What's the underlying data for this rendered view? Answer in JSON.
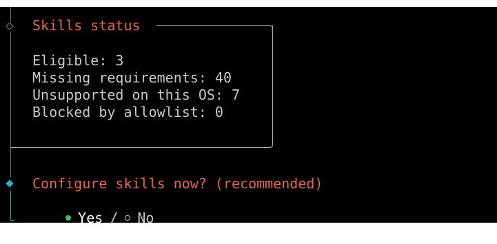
{
  "skills_status": {
    "title": "Skills status",
    "items": [
      {
        "label": "Eligible: 3"
      },
      {
        "label": "Missing requirements: 40"
      },
      {
        "label": "Unsupported on this OS: 7"
      },
      {
        "label": "Blocked by allowlist: 0"
      }
    ]
  },
  "prompt": {
    "question": "Configure skills now? (recommended)",
    "options": {
      "yes": "Yes",
      "separator": "/",
      "no": "No",
      "selected": "yes"
    }
  },
  "colors": {
    "title": "#e8654f",
    "text": "#c8c8c8",
    "selected_dot": "#3cc35a",
    "accent_gutter": "#1aa7b8",
    "background": "#000000"
  },
  "icons": {
    "step_done": "diamond-outline-icon",
    "step_active": "diamond-filled-icon",
    "selected": "radio-filled-icon",
    "unselected": "radio-empty-icon"
  }
}
